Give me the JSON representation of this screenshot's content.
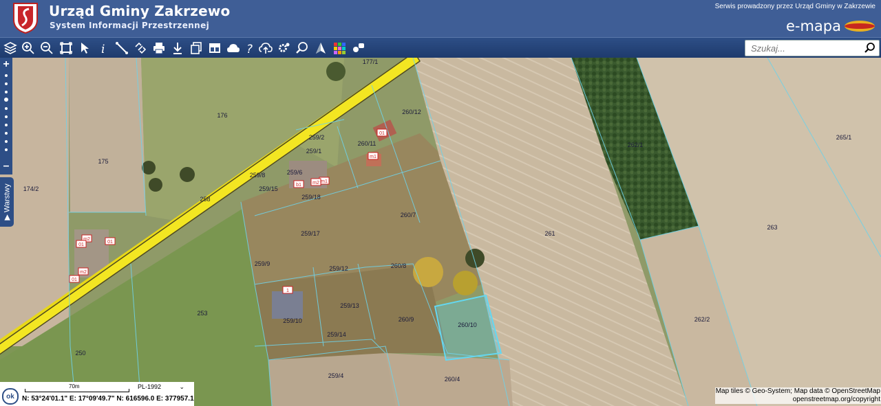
{
  "header": {
    "title": "Urząd Gminy Zakrzewo",
    "subtitle": "System Informacji Przestrzennej",
    "service_text": "Serwis prowadzony przez Urząd Gminy w Zakrzewie",
    "brand": "e-mapa"
  },
  "toolbar": {
    "icons": [
      "layers-icon",
      "zoom-in-icon",
      "zoom-out-icon",
      "zoom-extent-icon",
      "select-arrow-icon",
      "info-icon",
      "measure-distance-icon",
      "measure-link-icon",
      "print-icon",
      "download-icon",
      "copy-icon",
      "layout-icon",
      "cloud-icon",
      "help-icon",
      "upload-cloud-icon",
      "settings-icon",
      "magnifier-icon",
      "compass-icon",
      "color-grid-icon",
      "camera-icon"
    ]
  },
  "search": {
    "placeholder": "Szukaj..."
  },
  "sidebar": {
    "zoom_in": "+",
    "zoom_out": "–",
    "layers_label": "Warstwy"
  },
  "map": {
    "parcels": [
      "177/1",
      "176",
      "260/12",
      "259/2",
      "260/11",
      "259/1",
      "175",
      "174/2",
      "259/8",
      "259/6",
      "259/15",
      "259/18",
      "258",
      "262/1",
      "265/1",
      "260/7",
      "263",
      "259/17",
      "261",
      "259/9",
      "259/12",
      "260/8",
      "253",
      "259/13",
      "259/10",
      "260/9",
      "260/10",
      "262/2",
      "259/14",
      "250",
      "259/4",
      "260/4"
    ],
    "building_tags": [
      "m1",
      "m1",
      "m2",
      "m2",
      "b1",
      "01",
      "01",
      "01",
      "m2",
      "1",
      "01"
    ]
  },
  "status_bar": {
    "scale_label": "70m",
    "crs": "PL-1992",
    "ok_label": "ok",
    "coords": "N: 53°24'01.1\"  E: 17°09'49.7\"  N: 616596.0  E: 377957.1"
  },
  "attribution": {
    "line1": "Map tiles © Geo-System; Map data © OpenStreetMap",
    "line2": "openstreetmap.org/copyright"
  },
  "colors": {
    "header": "#3f5e96",
    "toolbar": "#2d4e86",
    "road": "#f0e020",
    "parcel_line": "#6fd2e8",
    "selected_parcel": "#5fd0f0"
  }
}
